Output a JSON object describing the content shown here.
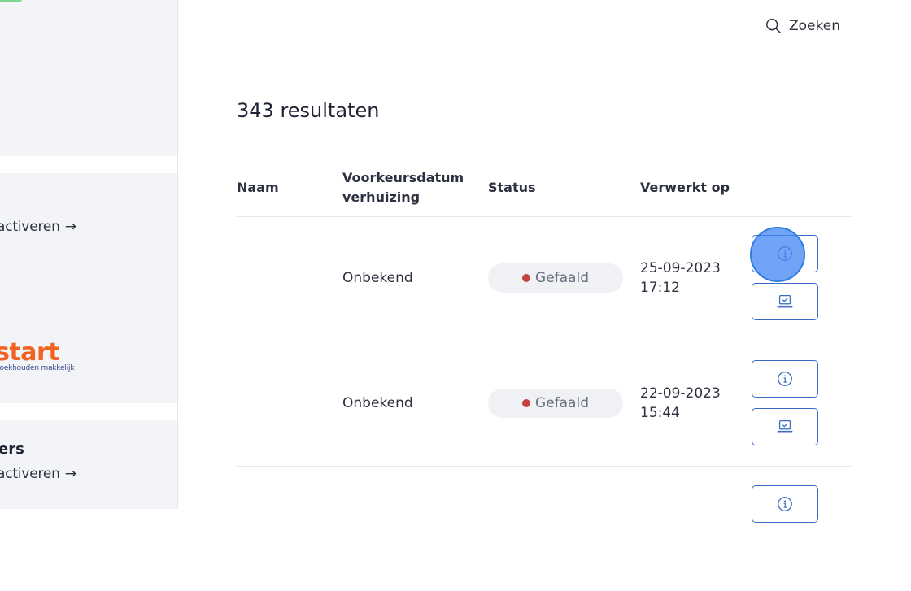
{
  "sidebar": {
    "link1": {
      "label": "activeren",
      "arrow": "→"
    },
    "logo": {
      "word": "start",
      "tagline": "boekhouden makkelijk"
    },
    "section2": {
      "title": "ers",
      "link": {
        "label": "activeren",
        "arrow": "→"
      }
    }
  },
  "header": {
    "search_label": "Zoeken"
  },
  "main": {
    "results_count": "343 resultaten",
    "table": {
      "columns": [
        "Naam",
        "Voorkeursdatum verhuizing",
        "Status",
        "Verwerkt op"
      ],
      "column_lines": {
        "naam": "Naam",
        "date_line1": "Voorkeursdatum",
        "date_line2": "verhuizing",
        "status": "Status",
        "processed": "Verwerkt op"
      },
      "rows": [
        {
          "name": "",
          "date": "Onbekend",
          "status": "Gefaald",
          "processed_date": "25-09-2023",
          "processed_time": "17:12"
        },
        {
          "name": "",
          "date": "Onbekend",
          "status": "Gefaald",
          "processed_date": "22-09-2023",
          "processed_time": "15:44"
        }
      ]
    }
  },
  "colors": {
    "accent": "#3a6bc4",
    "status_failed": "#c94040",
    "logo": "#f26322"
  }
}
